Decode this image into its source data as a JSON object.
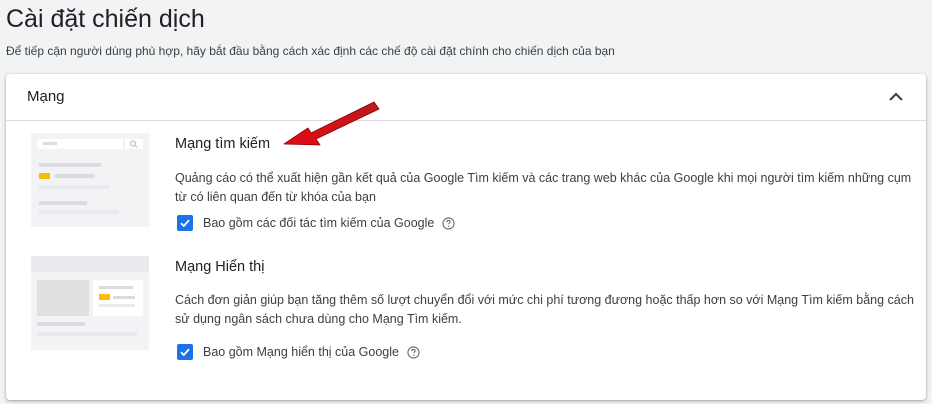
{
  "page": {
    "title": "Cài đặt chiến dịch",
    "subtitle": "Để tiếp cận người dùng phù hợp, hãy bắt đầu bằng cách xác định các chế độ cài đặt chính cho chiến dịch của bạn"
  },
  "networks_card": {
    "title": "Mạng",
    "search_network": {
      "title": "Mạng tìm kiếm",
      "description": "Quảng cáo có thể xuất hiện gần kết quả của Google Tìm kiếm và các trang web khác của Google khi mọi người tìm kiếm những cụm từ có liên quan đến từ khóa của bạn",
      "checkbox_label": "Bao gồm các đối tác tìm kiếm của Google",
      "checked": true
    },
    "display_network": {
      "title": "Mạng Hiển thị",
      "description": "Cách đơn giản giúp bạn tăng thêm số lượt chuyển đổi với mức chi phí tương đương hoặc thấp hơn so với Mạng Tìm kiếm bằng cách sử dụng ngân sách chưa dùng cho Mạng Tìm kiếm.",
      "checkbox_label": "Bao gồm Mạng hiển thị của Google",
      "checked": true
    }
  },
  "colors": {
    "accent": "#1a73e8",
    "thumbnail_highlight": "#fbbc04",
    "annotation_arrow": "#d50000"
  },
  "icons": {
    "collapse": "chevron-up-icon",
    "help": "help-circle-icon",
    "check": "checkmark-icon"
  }
}
